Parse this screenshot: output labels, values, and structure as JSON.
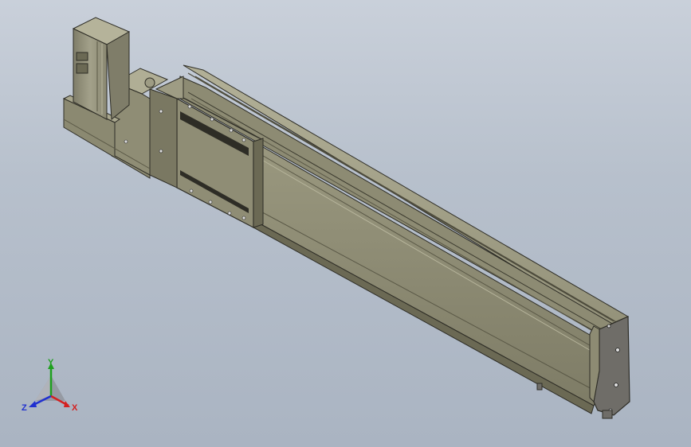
{
  "viewport": {
    "background_top": "#c9d0da",
    "background_bottom": "#aab4c2"
  },
  "model": {
    "body_color": "#8e8c74",
    "body_light": "#a8a68c",
    "body_dark": "#5e5c48",
    "end_cap_color": "#6f6d68",
    "edge_color": "#2e2d26"
  },
  "triad": {
    "x_label": "X",
    "y_label": "Y",
    "z_label": "Z",
    "x_color": "#d42020",
    "y_color": "#1fa01f",
    "z_color": "#2030d0"
  }
}
